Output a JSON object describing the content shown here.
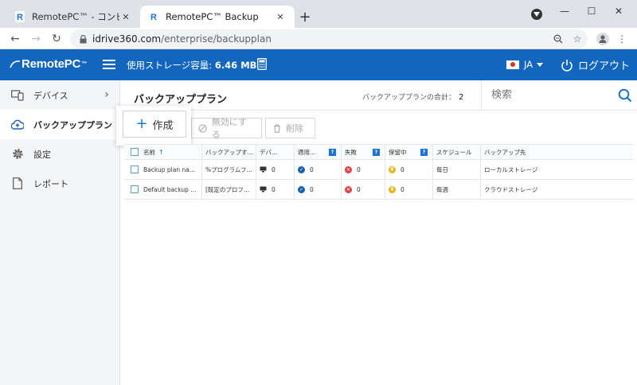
{
  "browser": {
    "tabs": [
      {
        "title": "RemotePC™ - コンピューター"
      },
      {
        "title": "RemotePC™ Backup"
      }
    ],
    "url_host": "idrive360.com",
    "url_path": "/enterprise/backupplan"
  },
  "app": {
    "logo": "RemotePC",
    "logo_tm": "™",
    "storage_label": "使用ストレージ容量:",
    "storage_value": "6.46 MB",
    "language": "JA",
    "logout_label": "ログアウト",
    "colors": {
      "header": "#1266be",
      "accent": "#1a74d1"
    }
  },
  "sidebar": {
    "items": [
      {
        "label": "デバイス",
        "icon": "devices-icon"
      },
      {
        "label": "バックアッププラン",
        "icon": "cloud-upload-icon"
      },
      {
        "label": "設定",
        "icon": "gear-icon"
      },
      {
        "label": "レポート",
        "icon": "document-icon"
      }
    ]
  },
  "main": {
    "title": "バックアッププラン",
    "total_label": "バックアッププランの合計：",
    "total_value": "2",
    "search_placeholder": "検索",
    "buttons": {
      "create": "作成",
      "disable": "無効にする",
      "delete": "削除"
    },
    "table": {
      "headers": [
        "名前",
        "バックアップす...",
        "デバ...",
        "適用...",
        "失敗",
        "保留中",
        "スケジュール",
        "バックアップ先"
      ],
      "rows": [
        {
          "name": "Backup plan na...",
          "backup": "%プログラムフ...",
          "devices": "0",
          "applied": "0",
          "failed": "0",
          "pending": "0",
          "schedule": "毎日",
          "destination": "ローカルストレージ"
        },
        {
          "name": "Default backup ...",
          "backup": "[既定のプロフ...",
          "devices": "0",
          "applied": "0",
          "failed": "0",
          "pending": "0",
          "schedule": "毎週",
          "destination": "クラウドストレージ"
        }
      ]
    }
  }
}
